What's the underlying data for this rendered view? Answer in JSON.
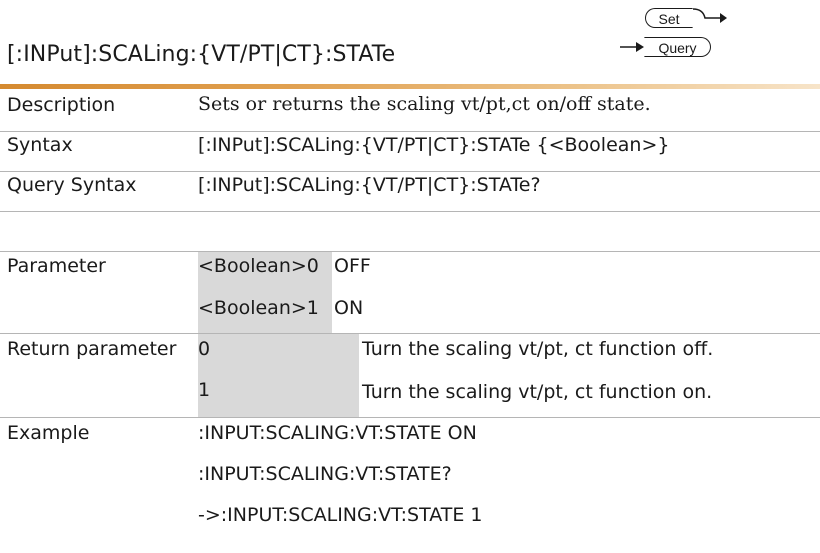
{
  "header": {
    "title": "[:INPut]:SCALing:{VT/PT|CT}:STATe",
    "set_badge": "Set",
    "query_badge": "Query"
  },
  "rows": {
    "description": {
      "label": "Description",
      "text": "Sets or returns the scaling vt/pt,ct on/off state."
    },
    "syntax": {
      "label": "Syntax",
      "text": "[:INPut]:SCALing:{VT/PT|CT}:STATe {<Boolean>}"
    },
    "query_syntax": {
      "label": "Query Syntax",
      "text": "[:INPut]:SCALing:{VT/PT|CT}:STATe?"
    },
    "parameter": {
      "label": "Parameter",
      "items": [
        {
          "name": "<Boolean>0",
          "value": "OFF"
        },
        {
          "name": "<Boolean>1",
          "value": "ON"
        }
      ]
    },
    "return_parameter": {
      "label": "Return parameter",
      "items": [
        {
          "name": "0",
          "value": "Turn the scaling vt/pt, ct function off."
        },
        {
          "name": "1",
          "value": "Turn the scaling vt/pt, ct function on."
        }
      ]
    },
    "example": {
      "label": "Example",
      "lines": [
        ":INPUT:SCALING:VT:STATE ON",
        ":INPUT:SCALING:VT:STATE?",
        "->:INPUT:SCALING:VT:STATE 1"
      ]
    }
  }
}
